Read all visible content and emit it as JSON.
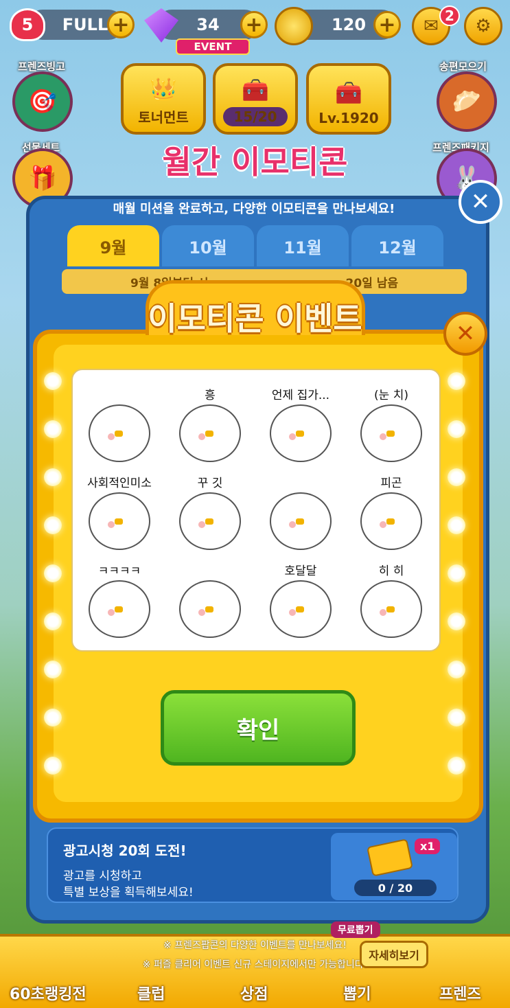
{
  "topbar": {
    "lives": "5",
    "lives_status": "FULL",
    "gems": "34",
    "event_tag": "EVENT",
    "coins": "120",
    "mail_badge": "2",
    "icons": [
      "heart-icon",
      "gem-icon",
      "coin-icon",
      "mail-icon",
      "gear-icon"
    ]
  },
  "side_left": [
    {
      "label": "프렌즈빙고"
    },
    {
      "label": "선물세트"
    }
  ],
  "side_right": [
    {
      "label": "송편모으기"
    },
    {
      "label": "프렌즈패키지"
    }
  ],
  "mid_buttons": {
    "tournament": "토너먼트",
    "chest_progress": "15/20",
    "level": "Lv.1920"
  },
  "monthly": {
    "title": "월간 이모티콘",
    "subtitle": "매월 미션을 완료하고, 다양한 이모티콘을 만나보세요!",
    "tabs": [
      "9월",
      "10월",
      "11월",
      "12월"
    ],
    "date_info": "9월 8일부터 시",
    "remaining": "20일 남음"
  },
  "modal": {
    "title": "이모티콘 이벤트",
    "confirm_label": "확인",
    "emoticons": [
      {
        "caption": ""
      },
      {
        "caption": "흥"
      },
      {
        "caption": "언제 집가..."
      },
      {
        "caption": "(눈 치)"
      },
      {
        "caption": "사회적인미소"
      },
      {
        "caption": "꾸   깃"
      },
      {
        "caption": ""
      },
      {
        "caption": "피곤"
      },
      {
        "caption": "ㅋㅋㅋㅋ"
      },
      {
        "caption": ""
      },
      {
        "caption": "호달달"
      },
      {
        "caption": "히 히"
      }
    ]
  },
  "ad": {
    "title": "광고시청 20회 도전!",
    "desc1": "광고를 시청하고",
    "desc2": "특별 보상을 획득해보세요!",
    "reward_count": "x1",
    "progress": "0 / 20"
  },
  "notices": [
    "※ 프렌즈팝콘의 다양한 이벤트를 만나보세요!",
    "※ 퍼즐 클리어 이벤트 신규 스테이지에서만 가능합니다!"
  ],
  "detail_button": "자세히보기",
  "free_tag": "무료뽑기",
  "bottom_nav": [
    "60초랭킹전",
    "클럽",
    "상점",
    "뽑기",
    "프렌즈"
  ]
}
